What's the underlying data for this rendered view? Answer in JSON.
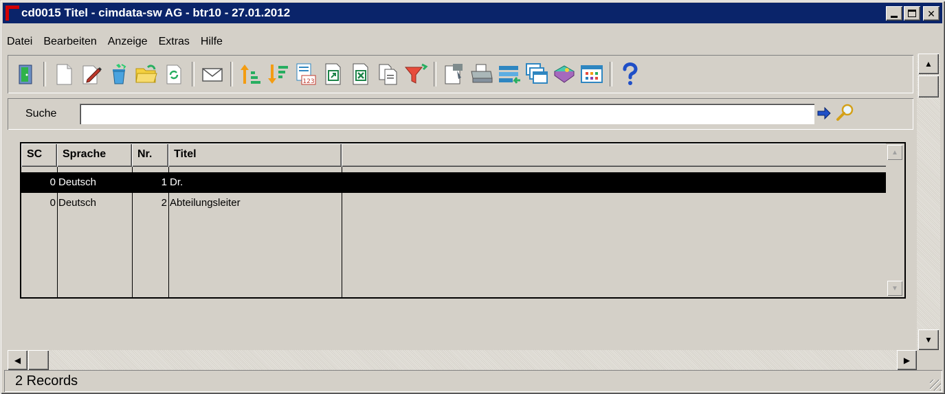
{
  "window": {
    "title": "cd0015 Titel - cimdata-sw AG - btr10 - 27.01.2012",
    "minimize_label": "",
    "maximize_label": "",
    "close_label": "✕"
  },
  "menu": [
    {
      "label": "Datei"
    },
    {
      "label": "Bearbeiten"
    },
    {
      "label": "Anzeige"
    },
    {
      "label": "Extras"
    },
    {
      "label": "Hilfe"
    }
  ],
  "toolbar": {
    "icons": [
      "exit-door-icon",
      "new-document-icon",
      "edit-pencil-icon",
      "recycle-delete-icon",
      "open-folder-icon",
      "refresh-icon",
      "email-envelope-icon",
      "sort-ascending-icon",
      "sort-descending-icon",
      "number-list-icon",
      "export-document-icon",
      "excel-export-icon",
      "copy-documents-icon",
      "filter-funnel-icon",
      "properties-icon",
      "printer-icon",
      "transfer-icon",
      "windows-cascade-icon",
      "book-icon",
      "table-grid-icon",
      "help-question-icon"
    ]
  },
  "search": {
    "label": "Suche",
    "value": "",
    "placeholder": ""
  },
  "table": {
    "columns": [
      "SC",
      "Sprache",
      "Nr.",
      "Titel",
      ""
    ],
    "rows": [
      {
        "sc": "0",
        "sprache": "Deutsch",
        "nr": "1",
        "titel": "Dr.",
        "selected": true
      },
      {
        "sc": "0",
        "sprache": "Deutsch",
        "nr": "2",
        "titel": "Abteilungsleiter",
        "selected": false
      }
    ]
  },
  "status": {
    "text": "2 Records"
  },
  "colors": {
    "titlebar": "#0a246a",
    "face": "#d4d0c8",
    "selection": "#000000"
  }
}
